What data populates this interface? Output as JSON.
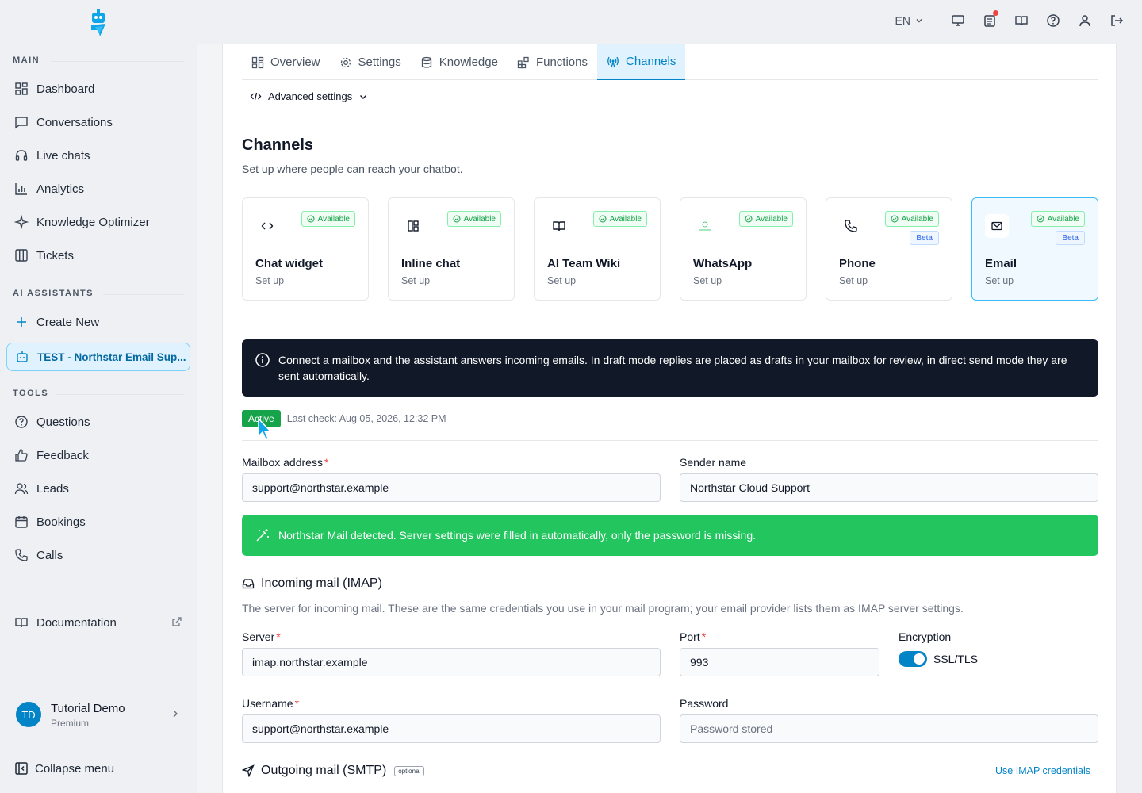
{
  "topbar": {
    "language": "EN"
  },
  "sidebar": {
    "main_label": "MAIN",
    "main_items": [
      {
        "label": "Dashboard",
        "icon": "dashboard-icon"
      },
      {
        "label": "Conversations",
        "icon": "chat-bubble-icon"
      },
      {
        "label": "Live chats",
        "icon": "headset-icon"
      },
      {
        "label": "Analytics",
        "icon": "bar-chart-icon"
      },
      {
        "label": "Knowledge Optimizer",
        "icon": "sparkles-icon"
      },
      {
        "label": "Tickets",
        "icon": "columns-icon"
      }
    ],
    "assistants_label": "AI ASSISTANTS",
    "create_new": "Create New",
    "active_assistant": "TEST - Northstar Email Sup...",
    "tools_label": "TOOLS",
    "tools_items": [
      {
        "label": "Questions",
        "icon": "question-icon"
      },
      {
        "label": "Feedback",
        "icon": "thumbs-up-icon"
      },
      {
        "label": "Leads",
        "icon": "users-icon"
      },
      {
        "label": "Bookings",
        "icon": "calendar-icon"
      },
      {
        "label": "Calls",
        "icon": "phone-icon"
      }
    ],
    "documentation": "Documentation",
    "user": {
      "initials": "TD",
      "name": "Tutorial Demo",
      "plan": "Premium"
    },
    "collapse": "Collapse menu"
  },
  "tabs": [
    {
      "label": "Overview",
      "icon": "grid-icon"
    },
    {
      "label": "Settings",
      "icon": "gear-icon"
    },
    {
      "label": "Knowledge",
      "icon": "database-icon"
    },
    {
      "label": "Functions",
      "icon": "blocks-icon"
    },
    {
      "label": "Channels",
      "icon": "broadcast-icon",
      "active": true
    }
  ],
  "advanced_settings": "Advanced settings",
  "channels": {
    "title": "Channels",
    "subtitle": "Set up where people can reach your chatbot.",
    "available_label": "Available",
    "beta_label": "Beta",
    "cards": [
      {
        "name": "Chat widget",
        "status": "Set up",
        "icon": "code-icon",
        "beta": false
      },
      {
        "name": "Inline chat",
        "status": "Set up",
        "icon": "layout-icon",
        "beta": false
      },
      {
        "name": "AI Team Wiki",
        "status": "Set up",
        "icon": "book-icon",
        "beta": false
      },
      {
        "name": "WhatsApp",
        "status": "Set up",
        "icon": "whatsapp-icon",
        "beta": false
      },
      {
        "name": "Phone",
        "status": "Set up",
        "icon": "phone-icon",
        "beta": true
      },
      {
        "name": "Email",
        "status": "Set up",
        "icon": "mail-icon",
        "beta": true,
        "selected": true
      }
    ]
  },
  "email": {
    "info": "Connect a mailbox and the assistant answers incoming emails. In draft mode replies are placed as drafts in your mailbox for review, in direct send mode they are sent automatically.",
    "status": "Active",
    "last_check": "Last check: Aug 05, 2026, 12:32 PM",
    "mailbox_label": "Mailbox address",
    "mailbox_value": "support@northstar.example",
    "sender_label": "Sender name",
    "sender_value": "Northstar Cloud Support",
    "detected": "Northstar Mail detected. Server settings were filled in automatically, only the password is missing.",
    "imap": {
      "title": "Incoming mail (IMAP)",
      "desc": "The server for incoming mail. These are the same credentials you use in your mail program; your email provider lists them as IMAP server settings.",
      "server_label": "Server",
      "server_value": "imap.northstar.example",
      "port_label": "Port",
      "port_value": "993",
      "encryption_label": "Encryption",
      "encryption_value": "SSL/TLS",
      "username_label": "Username",
      "username_value": "support@northstar.example",
      "password_label": "Password",
      "password_placeholder": "Password stored"
    },
    "smtp": {
      "title": "Outgoing mail (SMTP)",
      "optional": "optional",
      "use_imap": "Use IMAP credentials"
    }
  },
  "colors": {
    "accent": "#0284c7",
    "success": "#22c55e",
    "active_pill": "#16a34a",
    "info_bg": "#111827"
  }
}
